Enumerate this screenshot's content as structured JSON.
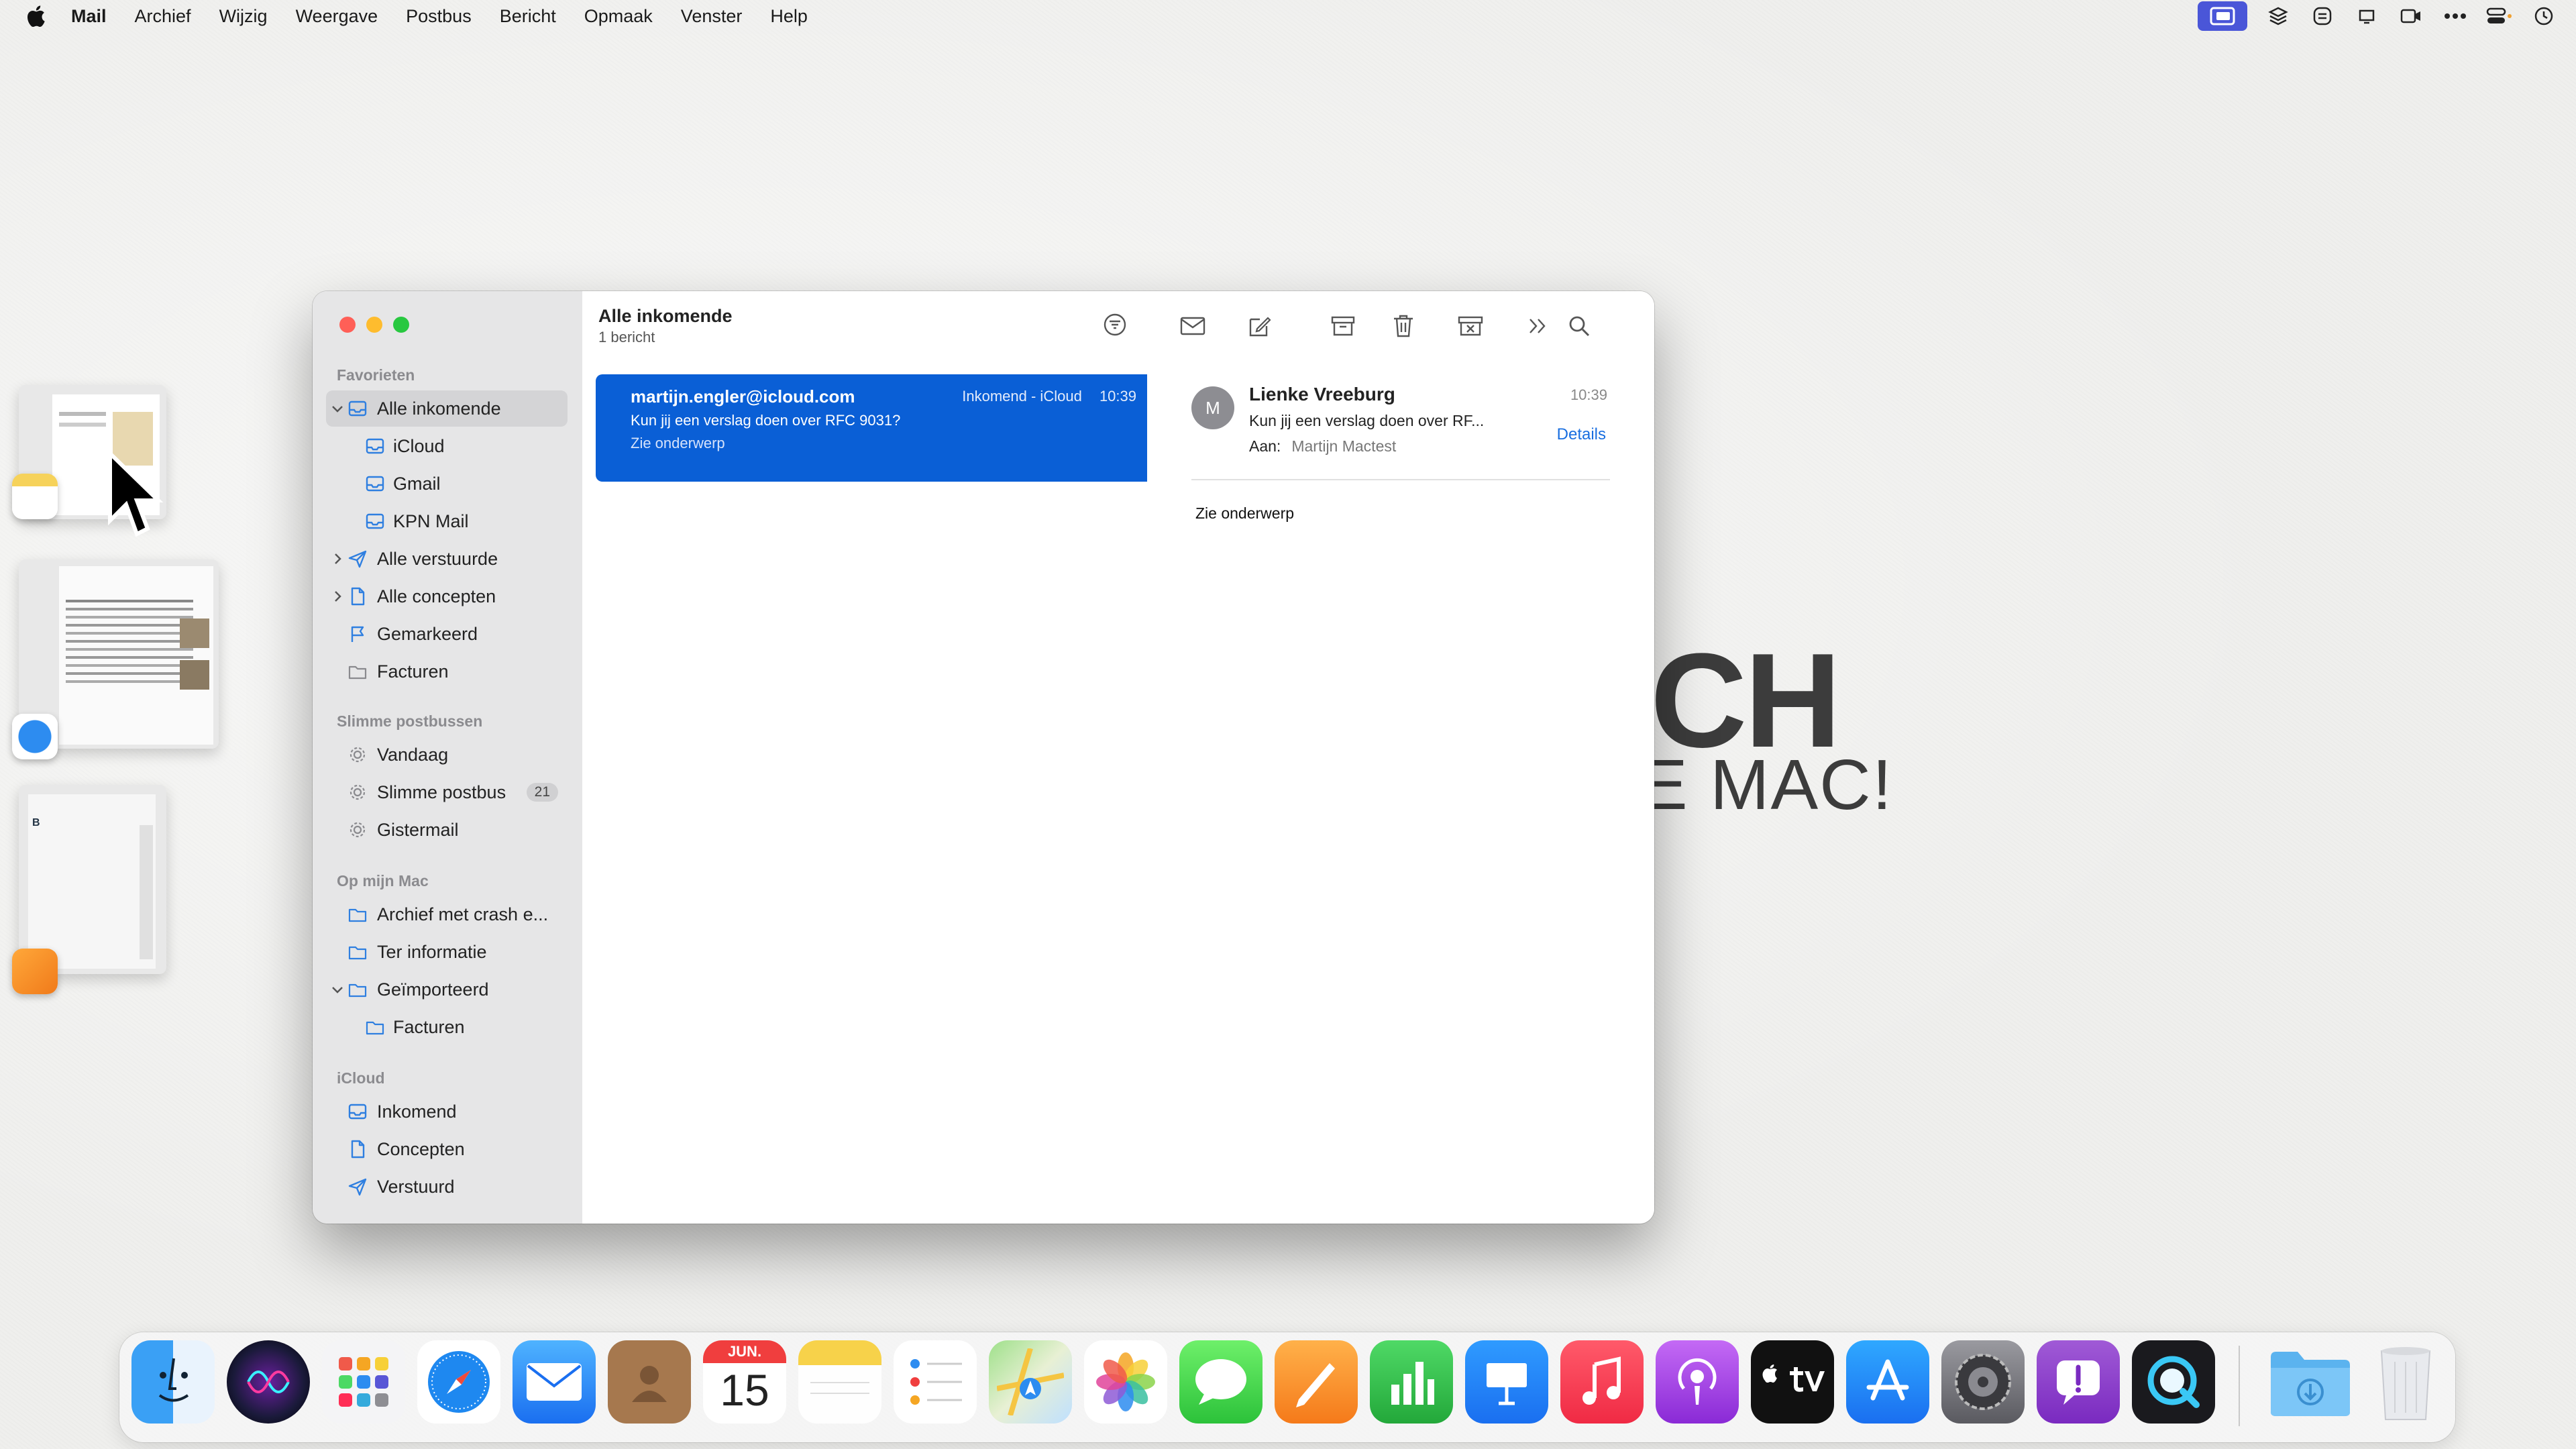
{
  "menubar": {
    "app": "Mail",
    "menus": [
      "Archief",
      "Wijzig",
      "Weergave",
      "Postbus",
      "Bericht",
      "Opmaak",
      "Venster",
      "Help"
    ]
  },
  "background_text": {
    "line1": "CH",
    "line2": "E MAC!"
  },
  "sidebar": {
    "sections": {
      "favorites": "Favorieten",
      "smart": "Slimme postbussen",
      "mac": "Op mijn Mac",
      "icloud": "iCloud"
    },
    "favorites": [
      {
        "label": "Alle inkomende"
      },
      {
        "label": "iCloud"
      },
      {
        "label": "Gmail"
      },
      {
        "label": "KPN Mail"
      },
      {
        "label": "Alle verstuurde"
      },
      {
        "label": "Alle concepten"
      },
      {
        "label": "Gemarkeerd"
      },
      {
        "label": "Facturen"
      }
    ],
    "smart": [
      {
        "label": "Vandaag"
      },
      {
        "label": "Slimme postbus",
        "badge": "21"
      },
      {
        "label": "Gistermail"
      }
    ],
    "mac": [
      {
        "label": "Archief met crash e..."
      },
      {
        "label": "Ter informatie"
      },
      {
        "label": "Geïmporteerd"
      },
      {
        "label": "Facturen"
      }
    ],
    "icloud": [
      {
        "label": "Inkomend"
      },
      {
        "label": "Concepten"
      },
      {
        "label": "Verstuurd"
      }
    ]
  },
  "list": {
    "title": "Alle inkomende",
    "count": "1 bericht",
    "message": {
      "from": "martijn.engler@icloud.com",
      "mailbox": "Inkomend - iCloud",
      "time": "10:39",
      "subject": "Kun jij een verslag doen over RFC 9031?",
      "preview": "Zie onderwerp"
    }
  },
  "detail": {
    "avatar": "M",
    "from": "Lienke Vreeburg",
    "time": "10:39",
    "subject": "Kun jij een verslag doen over RF...",
    "to_label": "Aan:",
    "to": "Martijn Mactest",
    "details_link": "Details",
    "body": "Zie onderwerp"
  },
  "dock": {
    "calendar_month": "JUN.",
    "calendar_day": "15"
  },
  "colors": {
    "accent": "#0a5fd6",
    "close": "#ff5f57",
    "minimize": "#febc2e",
    "zoom": "#28c840"
  }
}
